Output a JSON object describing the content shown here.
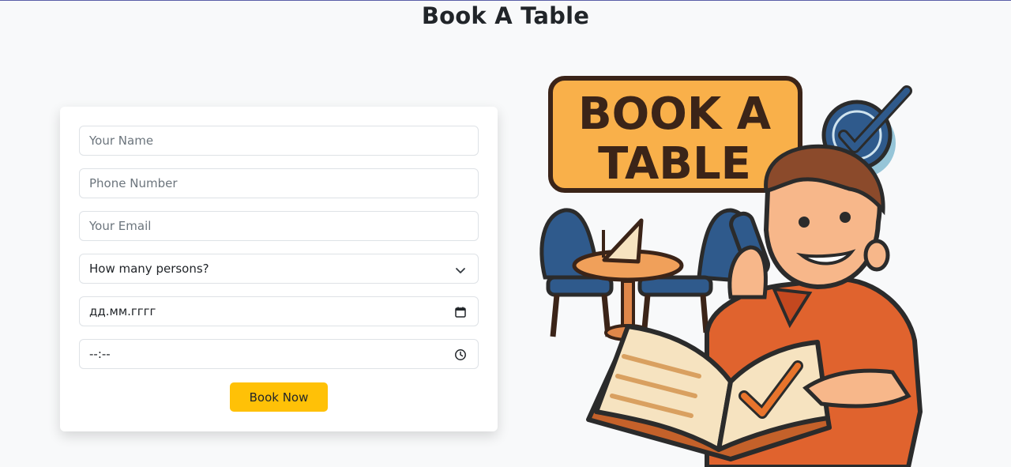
{
  "header": {
    "title": "Book A Table"
  },
  "form": {
    "name_placeholder": "Your Name",
    "phone_placeholder": "Phone Number",
    "email_placeholder": "Your Email",
    "persons_select": "How many persons?",
    "date_value": "дд.мм.гггг",
    "time_value": "--:--",
    "submit_label": "Book Now"
  },
  "illustration": {
    "sign_line1": "BOOK A",
    "sign_line2": "TABLE"
  },
  "colors": {
    "accent": "#ffc107",
    "page_bg": "#f8f9fa",
    "sign_orange": "#f9b04a",
    "chair_blue": "#2f5a8c",
    "shirt_orange": "#e0632e",
    "check_orange": "#e8742c"
  },
  "icons": [
    "chevron-down-icon",
    "calendar-icon",
    "clock-icon"
  ]
}
